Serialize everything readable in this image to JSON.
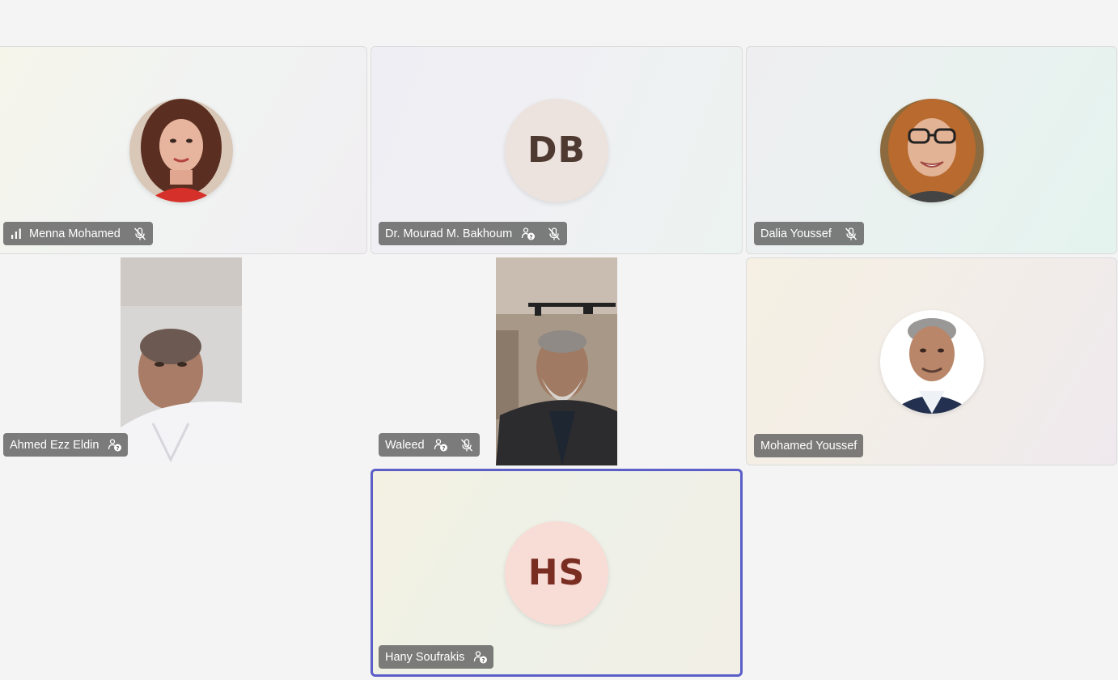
{
  "participants": [
    {
      "name": "Menna Mohamed",
      "icons": [
        "signal-bars-icon",
        "mic-off-icon"
      ]
    },
    {
      "name": "Dr. Mourad M. Bakhoum",
      "initials": "DB",
      "icons": [
        "person-question-icon",
        "mic-off-icon"
      ]
    },
    {
      "name": "Dalia Youssef",
      "icons": [
        "mic-off-icon"
      ]
    },
    {
      "name": "Ahmed Ezz Eldin",
      "icons": [
        "person-question-icon"
      ]
    },
    {
      "name": "Waleed",
      "icons": [
        "person-question-icon",
        "mic-off-icon"
      ]
    },
    {
      "name": "Mohamed Youssef",
      "icons": []
    },
    {
      "name": "Hany Soufrakis",
      "initials": "HS",
      "icons": [
        "person-question-icon"
      ],
      "active_speaker": true
    }
  ],
  "colors": {
    "page_background": "#f4f4f4",
    "active_speaker_border": "#5b5fc7",
    "name_label_background": "#606060",
    "initials_db_background": "#ece2de",
    "initials_hs_background": "#f8dcd6"
  }
}
